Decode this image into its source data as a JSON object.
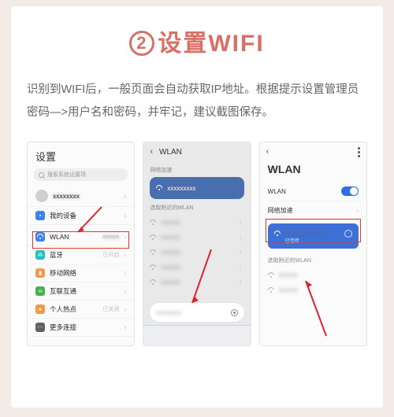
{
  "title": {
    "num": "2",
    "text": "设置WIFI"
  },
  "description": "识别到WIFI后，一般页面会自动获取IP地址。根据提示设置管理员密码—>用户名和密码，并牢记，建议截图保存。",
  "screen1": {
    "heading": "设置",
    "search_placeholder": "搜索系统设置项",
    "rows": [
      {
        "icon": "gray",
        "label": "",
        "sub": ""
      },
      {
        "icon": "blue",
        "label": "我的设备",
        "sub": ""
      },
      {
        "icon": "blue",
        "label": "WLAN",
        "sub": ""
      },
      {
        "icon": "teal",
        "label": "蓝牙",
        "sub": "已开启"
      },
      {
        "icon": "orange",
        "label": "移动网络",
        "sub": ""
      },
      {
        "icon": "green",
        "label": "互联互通",
        "sub": ""
      },
      {
        "icon": "orange",
        "label": "个人热点",
        "sub": "已关闭"
      },
      {
        "icon": "dark",
        "label": "更多连接",
        "sub": ""
      }
    ],
    "highlight_index": 2
  },
  "screen2": {
    "back": "‹",
    "title": "WLAN",
    "section_accel": "网络加速",
    "section_nearby": "选取附近的WLAN",
    "password_placeholder": "输入密码"
  },
  "screen3": {
    "back": "‹",
    "heading": "WLAN",
    "toggle_label": "WLAN",
    "accel_label": "网络加速",
    "connected_status": "已连接",
    "section_nearby": "选取附近的WLAN"
  }
}
